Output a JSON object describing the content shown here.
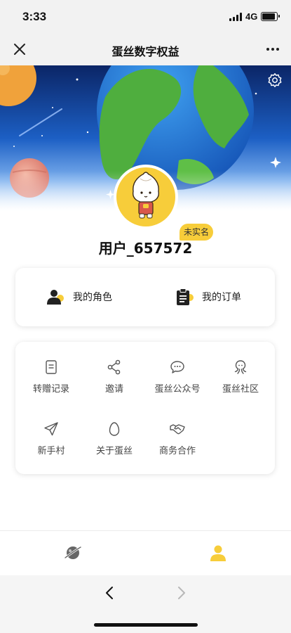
{
  "status_bar": {
    "time": "3:33",
    "network": "4G",
    "battery_level": 0.8
  },
  "nav": {
    "title": "蛋丝数字权益"
  },
  "profile": {
    "verify_badge": "未实名",
    "username": "用户_657572"
  },
  "quick_actions": [
    {
      "label": "我的角色",
      "icon": "user-role-icon"
    },
    {
      "label": "我的订单",
      "icon": "clipboard-icon"
    }
  ],
  "menu": [
    {
      "label": "转赠记录",
      "icon": "document-icon"
    },
    {
      "label": "邀请",
      "icon": "share-icon"
    },
    {
      "label": "蛋丝公众号",
      "icon": "chat-bubble-icon"
    },
    {
      "label": "蛋丝社区",
      "icon": "octopus-icon"
    },
    {
      "label": "新手村",
      "icon": "paper-plane-icon"
    },
    {
      "label": "关于蛋丝",
      "icon": "egg-icon"
    },
    {
      "label": "商务合作",
      "icon": "handshake-icon"
    }
  ],
  "tab_bar": {
    "active_tab": "profile",
    "tabs": [
      "planet-icon",
      "profile-icon"
    ]
  },
  "colors": {
    "accent": "#f7cd3a",
    "text": "#222222",
    "sky_top": "#0d2a6e",
    "earth_green": "#4fae3e",
    "ocean_blue": "#2f8de0"
  }
}
